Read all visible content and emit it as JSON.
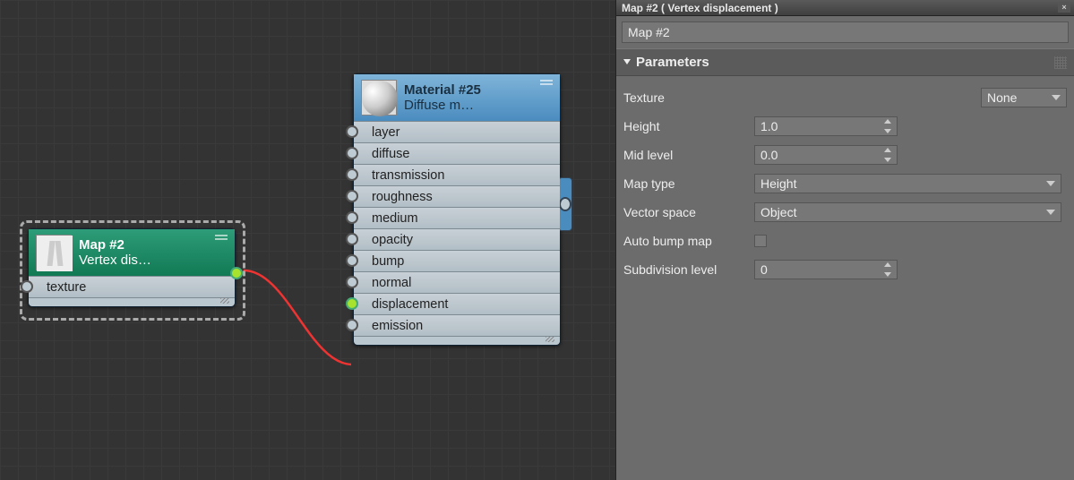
{
  "panel": {
    "titlebar": "Map #2  ( Vertex displacement )",
    "name_field": "Map #2",
    "section": "Parameters",
    "params": {
      "texture_label": "Texture",
      "texture_value": "None",
      "height_label": "Height",
      "height_value": "1.0",
      "midlevel_label": "Mid level",
      "midlevel_value": "0.0",
      "maptype_label": "Map type",
      "maptype_value": "Height",
      "vectorspace_label": "Vector space",
      "vectorspace_value": "Object",
      "autobump_label": "Auto bump map",
      "subdiv_label": "Subdivision level",
      "subdiv_value": "0"
    }
  },
  "nodegreen": {
    "title": "Map #2",
    "subtitle": "Vertex dis…",
    "row0": "texture"
  },
  "nodeblue": {
    "title": "Material #25",
    "subtitle": "Diffuse m…",
    "rows": [
      "layer",
      "diffuse",
      "transmission",
      "roughness",
      "medium",
      "opacity",
      "bump",
      "normal",
      "displacement",
      "emission"
    ]
  }
}
